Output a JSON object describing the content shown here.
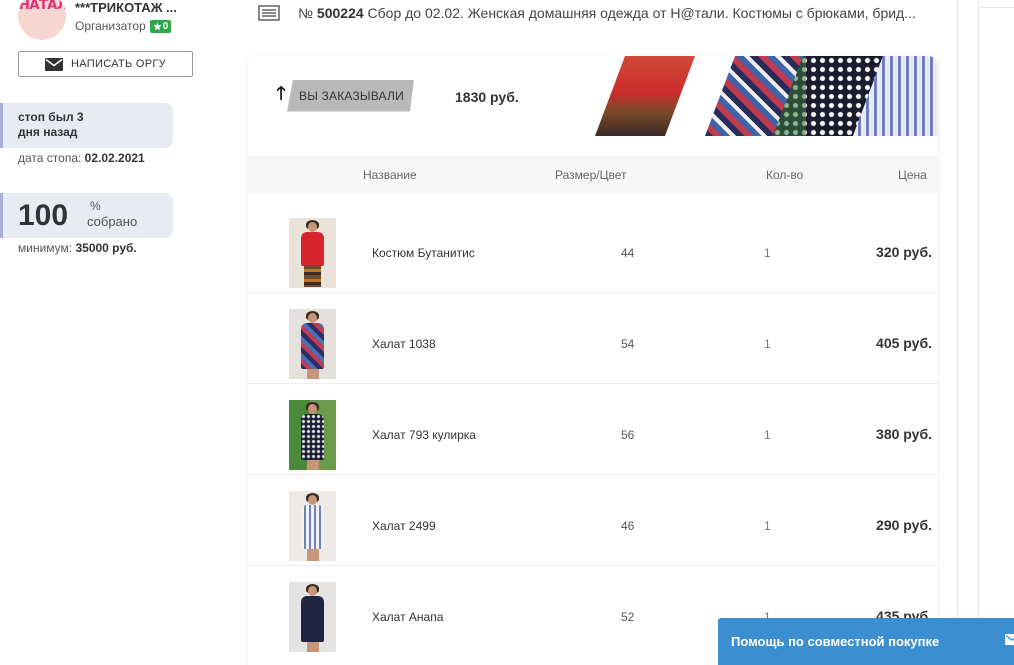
{
  "organizer": {
    "logo_text": "НАТАЛИ",
    "name": "***ТРИКОТАЖ ...",
    "role": "Организатор",
    "rating": "0",
    "message_button": "НАПИСАТЬ ОРГУ"
  },
  "stop": {
    "line1": "стоп был 3",
    "line2": "дня назад",
    "date_label": "дата стопа:",
    "date_value": "02.02.2021"
  },
  "collected": {
    "value": "100",
    "percent": "%",
    "label": "собрано",
    "minimum_label": "минимум:",
    "minimum_value": "35000 руб."
  },
  "purchase": {
    "number_prefix": "№",
    "number": "500224",
    "title": "Сбор до 02.02. Женская домашняя одежда от Н@тали. Костюмы с брюками, брид..."
  },
  "banner": {
    "ordered_label": "ВЫ ЗАКАЗЫВАЛИ",
    "total": "1830 руб."
  },
  "table": {
    "headers": {
      "name": "Название",
      "size": "Размер/Цвет",
      "qty": "Кол-во",
      "price": "Цена"
    },
    "rows": [
      {
        "name": "Костюм Бутанитис",
        "size": "44",
        "qty": "1",
        "price": "320 руб."
      },
      {
        "name": "Халат 1038",
        "size": "54",
        "qty": "1",
        "price": "405 руб."
      },
      {
        "name": "Халат 793 кулирка",
        "size": "56",
        "qty": "1",
        "price": "380 руб."
      },
      {
        "name": "Халат 2499",
        "size": "46",
        "qty": "1",
        "price": "290 руб."
      },
      {
        "name": "Халат Анапа",
        "size": "52",
        "qty": "1",
        "price": "435 руб."
      }
    ]
  },
  "help": {
    "label": "Помощь по совместной покупке"
  },
  "colors": {
    "accent_blue": "#3b8fd0",
    "badge_green": "#2ea84a",
    "info_box": "#e8ebf4"
  }
}
